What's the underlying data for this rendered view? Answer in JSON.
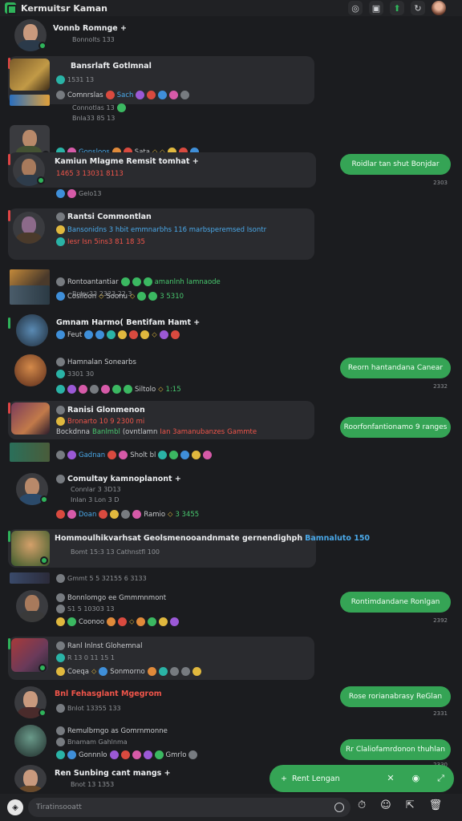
{
  "app": {
    "title": "Kermuitsr Kaman"
  },
  "top_icons": [
    "sync-icon",
    "image-icon",
    "upload-icon",
    "refresh-icon",
    "user-avatar"
  ],
  "messages": [
    {
      "name": "Vonnb Romnge +",
      "meta": "Bonnolts 133"
    },
    {
      "name": "Bansrlaft Gotlmnal",
      "meta": "1531 13",
      "line3": "Comnrslas",
      "line4": "Connotlas 13",
      "line5": "Bnla33 85 13",
      "line6": "Gonsloos"
    },
    {
      "name": "Kamiun Mlagme Remsit tomhat +",
      "meta": "1465 3 13031 8113",
      "meta2": "Gelo13",
      "reply": "Roidlar tan shut Bonjdar",
      "reply_time": "2303"
    },
    {
      "name": "Rantsi Commontlan",
      "line2": "Bansonidns 3 hbit emmnarbhs 116 marbsperemsed Isontr",
      "line3": "Iesr Isn 5ins3 81 18 35",
      "line4": "Rontoantantiar",
      "line4b": "amanlnh lamnaode",
      "line5": "Bnlar33 2323 22 3",
      "line6": "Cosiloon",
      "line6b": "3 5310"
    },
    {
      "name": "Gmnam Harmo( Bentifam Hamt +",
      "meta": "Feut"
    },
    {
      "name": "Hamnalan Sonearbs",
      "meta": "3301 30",
      "line3": "Siltolo",
      "line3b": "1:15",
      "reply": "Reorn hantandana Canear",
      "reply_time": "2332"
    },
    {
      "name": "Ranisi Glonmenon",
      "line2": "Bronarto 10 9 2300 mi",
      "line3": "Bockdnna",
      "line3b": "Banlmbl",
      "line3c": "(ovntlamn",
      "line3d": "Ian 3amanubanzes",
      "line3e": "Ientgne",
      "line3f": "Gammte",
      "line4": "Gadnan",
      "line4b": "Sholt bl",
      "reply": "Roorfonfantionamo 9 ranges"
    },
    {
      "name": "Comultay kamnoplanont +",
      "meta": "Connlar 3 3D13",
      "meta2": "Inlan 3 Lon 3 D",
      "line4": "Doan",
      "line4b": "Ramio",
      "line4c": "3 3455"
    },
    {
      "name": "Hommoulhikvarhsat",
      "name_b": "Geolsmenooandnmate gernendighph",
      "name_c": "Bamnaluto 150",
      "meta": "Bomt 15:3 13 Cathnstfl 100"
    },
    {
      "line1": "Gmmt 5 5 32155 6 3133"
    },
    {
      "name": "Bonnlomgo ee Gmmmnmont",
      "meta": "S1 5 10303 13",
      "line3": "Coonoo",
      "reply": "Rontimdandane Ronlgan",
      "reply_time": "2392"
    },
    {
      "name": "Ranl Inlnst Glohemnal",
      "meta": "R 13 0 11 15 1",
      "line3": "Coeqa",
      "line3b": "Sonmorno"
    },
    {
      "name": "Bnl Fehasglant Mgegrom",
      "name_b": "3 5 lolo 13",
      "meta": "Bnlot 13355 133",
      "reply": "Rose rorianabrasy ReGlan",
      "reply_time": "2331"
    },
    {
      "name": "Remulbrngo as Gomrnmonne",
      "meta": "Bnamam Gahlnma",
      "line3": "Gonnnlo",
      "line3b": "Gmrlo",
      "reply": "Rr Claliofamrdonon thuhlan",
      "reply_time": "2330"
    },
    {
      "name": "Ren Sunbing cant mangs +",
      "meta": "Bnot 13 1353"
    }
  ],
  "quickbar": {
    "label": "Rent Lengan",
    "icons": [
      "send-icon",
      "close-icon",
      "sticker-icon",
      "expand-icon"
    ]
  },
  "composer": {
    "placeholder": "Tiratinsooatt"
  },
  "colors": {
    "accent": "#35a455",
    "background": "#1b1c1f",
    "card": "#2a2b2f",
    "alert": "#e04545"
  }
}
